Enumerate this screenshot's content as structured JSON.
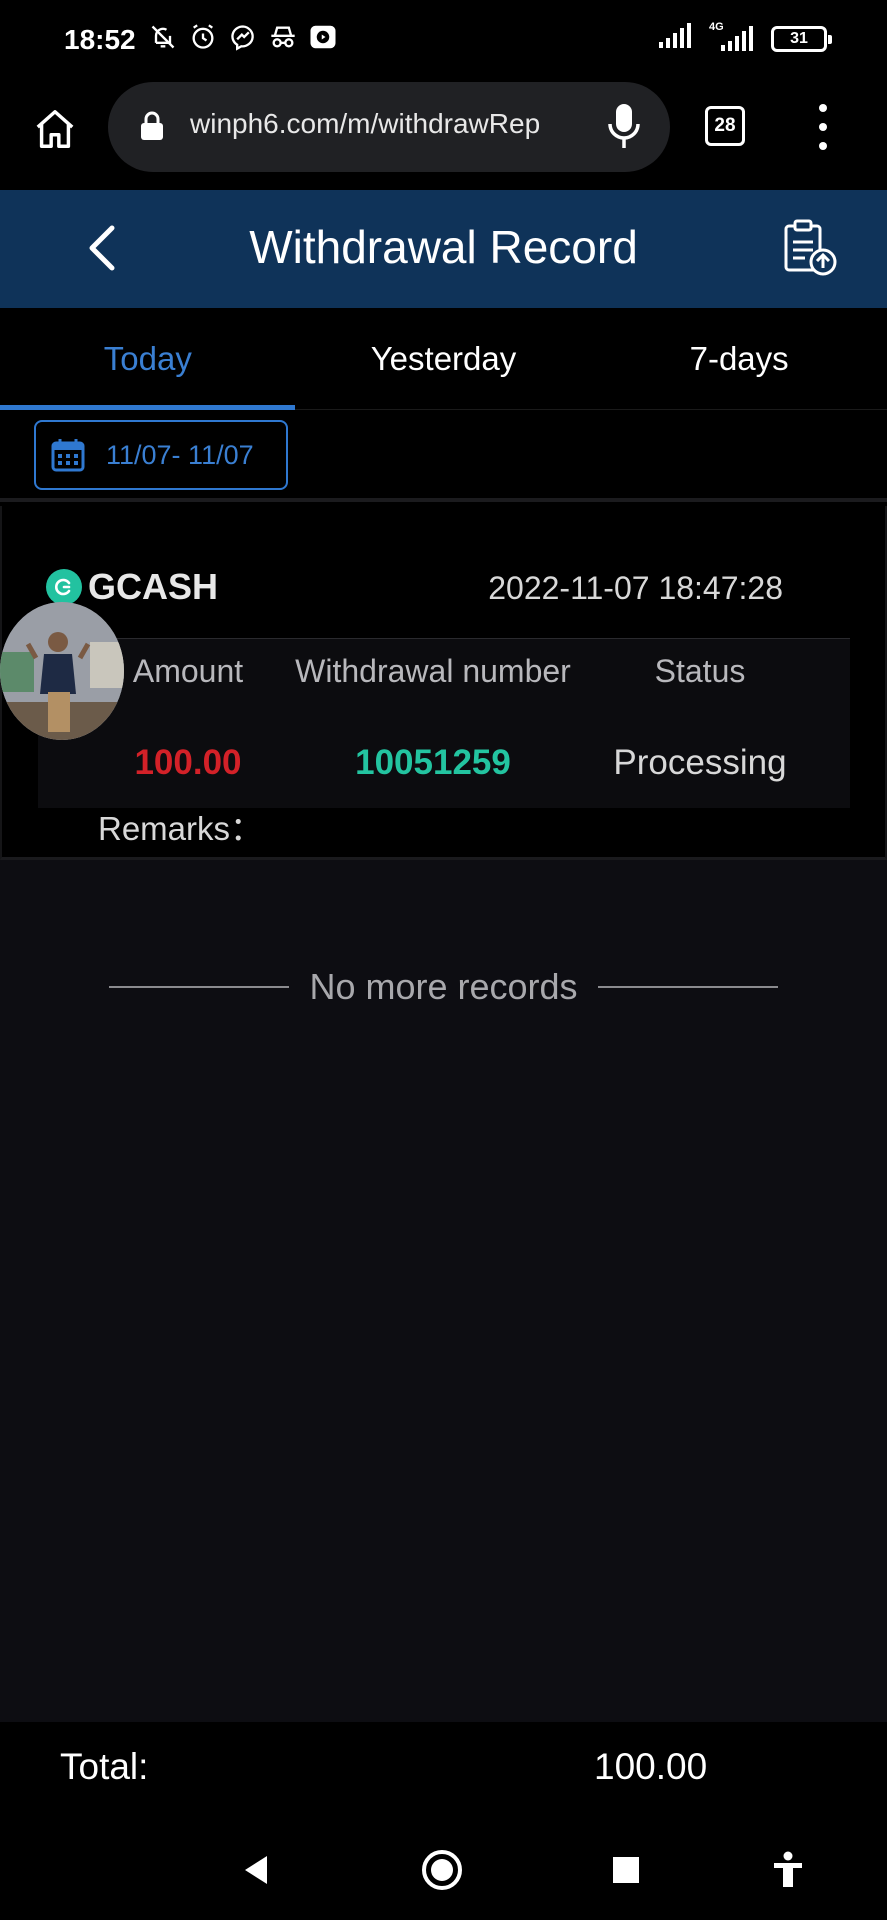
{
  "status_bar": {
    "time": "18:52",
    "network_label": "4G",
    "battery": "31"
  },
  "browser": {
    "url": "winph6.com/m/withdrawRep",
    "tab_count": "28"
  },
  "header": {
    "title": "Withdrawal Record"
  },
  "tabs": [
    {
      "label": "Today",
      "active": true
    },
    {
      "label": "Yesterday",
      "active": false
    },
    {
      "label": "7-days",
      "active": false
    }
  ],
  "date_filter": {
    "range": "11/07- 11/07"
  },
  "record": {
    "method": "GCASH",
    "datetime": "2022-11-07 18:47:28",
    "columns": {
      "amount": "Amount",
      "number": "Withdrawal number",
      "status": "Status"
    },
    "amount": "100.00",
    "number": "10051259",
    "status": "Processing",
    "remarks_label": "Remarks："
  },
  "list": {
    "end_text": "No more records"
  },
  "footer": {
    "total_label": "Total:",
    "total_value": "100.00"
  },
  "colors": {
    "header_bg": "#0f3359",
    "accent": "#2f78d0",
    "amount": "#d32128",
    "number": "#23c4a0"
  }
}
